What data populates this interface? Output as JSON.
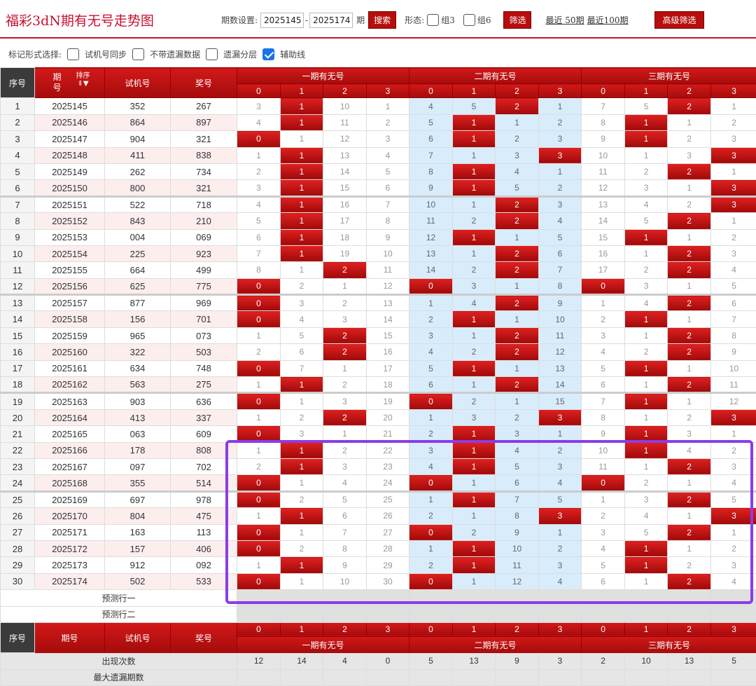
{
  "header": {
    "title": "福彩3dN期有无号走势图",
    "period_label": "期数设置:",
    "period_start": "2025145",
    "period_end": "2025174",
    "period_unit": "期",
    "search": "搜索",
    "form_label": "形态:",
    "group3": "组3",
    "group6": "组6",
    "filter": "筛选",
    "recent50": "最近 50期",
    "recent100": "最近100期",
    "advanced": "高级筛选"
  },
  "options": {
    "label": "标记形式选择:",
    "items": [
      {
        "label": "试机号同步",
        "checked": false
      },
      {
        "label": "不带遗漏数据",
        "checked": false
      },
      {
        "label": "遗漏分层",
        "checked": false
      },
      {
        "label": "辅助线",
        "checked": true
      }
    ]
  },
  "table": {
    "col_seq": "序号",
    "col_period": "期号",
    "col_sort": "排序",
    "col_test": "试机号",
    "col_prize": "奖号",
    "groups": [
      "一期有无号",
      "二期有无号",
      "三期有无号"
    ],
    "digits": [
      "0",
      "1",
      "2",
      "3"
    ],
    "rows": [
      [
        "1",
        "2025145",
        "352",
        "267",
        [
          3,
          "H1",
          10,
          1
        ],
        [
          4,
          5,
          "H2",
          1
        ],
        [
          7,
          5,
          "H2",
          1
        ]
      ],
      [
        "2",
        "2025146",
        "864",
        "897",
        [
          4,
          "H1",
          11,
          2
        ],
        [
          5,
          "H1",
          1,
          2
        ],
        [
          8,
          "H1",
          1,
          2
        ]
      ],
      [
        "3",
        "2025147",
        "904",
        "321",
        [
          "H0",
          1,
          12,
          3
        ],
        [
          6,
          "H1",
          2,
          3
        ],
        [
          9,
          "H1",
          2,
          3
        ]
      ],
      [
        "4",
        "2025148",
        "411",
        "838",
        [
          1,
          "H1",
          13,
          4
        ],
        [
          7,
          1,
          3,
          "H3"
        ],
        [
          10,
          1,
          3,
          "H3"
        ]
      ],
      [
        "5",
        "2025149",
        "262",
        "734",
        [
          2,
          "H1",
          14,
          5
        ],
        [
          8,
          "H1",
          4,
          1
        ],
        [
          11,
          2,
          "H2",
          1
        ]
      ],
      [
        "6",
        "2025150",
        "800",
        "321",
        [
          3,
          "H1",
          15,
          6
        ],
        [
          9,
          "H1",
          5,
          2
        ],
        [
          12,
          3,
          1,
          "H3"
        ]
      ],
      [
        "7",
        "2025151",
        "522",
        "718",
        [
          4,
          "H1",
          16,
          7
        ],
        [
          10,
          1,
          "H2",
          3
        ],
        [
          13,
          4,
          2,
          "H3"
        ]
      ],
      [
        "8",
        "2025152",
        "843",
        "210",
        [
          5,
          "H1",
          17,
          8
        ],
        [
          11,
          2,
          "H2",
          4
        ],
        [
          14,
          5,
          "H2",
          1
        ]
      ],
      [
        "9",
        "2025153",
        "004",
        "069",
        [
          6,
          "H1",
          18,
          9
        ],
        [
          12,
          "H1",
          1,
          5
        ],
        [
          15,
          "H1",
          1,
          2
        ]
      ],
      [
        "10",
        "2025154",
        "225",
        "923",
        [
          7,
          "H1",
          19,
          10
        ],
        [
          13,
          1,
          "H2",
          6
        ],
        [
          16,
          1,
          "H2",
          3
        ]
      ],
      [
        "11",
        "2025155",
        "664",
        "499",
        [
          8,
          1,
          "H2",
          11
        ],
        [
          14,
          2,
          "H2",
          7
        ],
        [
          17,
          2,
          "H2",
          4
        ]
      ],
      [
        "12",
        "2025156",
        "625",
        "775",
        [
          "H0",
          2,
          1,
          12
        ],
        [
          "H0",
          3,
          1,
          8
        ],
        [
          "H0",
          3,
          1,
          5
        ]
      ],
      [
        "13",
        "2025157",
        "877",
        "969",
        [
          "H0",
          3,
          2,
          13
        ],
        [
          1,
          4,
          "H2",
          9
        ],
        [
          1,
          4,
          "H2",
          6
        ]
      ],
      [
        "14",
        "2025158",
        "156",
        "701",
        [
          "H0",
          4,
          3,
          14
        ],
        [
          2,
          "H1",
          1,
          10
        ],
        [
          2,
          "H1",
          1,
          7
        ]
      ],
      [
        "15",
        "2025159",
        "965",
        "073",
        [
          1,
          5,
          "H2",
          15
        ],
        [
          3,
          1,
          "H2",
          11
        ],
        [
          3,
          1,
          "H2",
          8
        ]
      ],
      [
        "16",
        "2025160",
        "322",
        "503",
        [
          2,
          6,
          "H2",
          16
        ],
        [
          4,
          2,
          "H2",
          12
        ],
        [
          4,
          2,
          "H2",
          9
        ]
      ],
      [
        "17",
        "2025161",
        "634",
        "748",
        [
          "H0",
          7,
          1,
          17
        ],
        [
          5,
          "H1",
          1,
          13
        ],
        [
          5,
          "H1",
          1,
          10
        ]
      ],
      [
        "18",
        "2025162",
        "563",
        "275",
        [
          1,
          "H1",
          2,
          18
        ],
        [
          6,
          1,
          "H2",
          14
        ],
        [
          6,
          1,
          "H2",
          11
        ]
      ],
      [
        "19",
        "2025163",
        "903",
        "636",
        [
          "H0",
          1,
          3,
          19
        ],
        [
          "H0",
          2,
          1,
          15
        ],
        [
          7,
          "H1",
          1,
          12
        ]
      ],
      [
        "20",
        "2025164",
        "413",
        "337",
        [
          1,
          2,
          "H2",
          20
        ],
        [
          1,
          3,
          2,
          "H3"
        ],
        [
          8,
          1,
          2,
          "H3"
        ]
      ],
      [
        "21",
        "2025165",
        "063",
        "609",
        [
          "H0",
          3,
          1,
          21
        ],
        [
          2,
          "H1",
          3,
          1
        ],
        [
          9,
          "H1",
          3,
          1
        ]
      ],
      [
        "22",
        "2025166",
        "178",
        "808",
        [
          1,
          "H1",
          2,
          22
        ],
        [
          3,
          "H1",
          4,
          2
        ],
        [
          10,
          "H1",
          4,
          2
        ]
      ],
      [
        "23",
        "2025167",
        "097",
        "702",
        [
          2,
          "H1",
          3,
          23
        ],
        [
          4,
          "H1",
          5,
          3
        ],
        [
          11,
          1,
          "H2",
          3
        ]
      ],
      [
        "24",
        "2025168",
        "355",
        "514",
        [
          "H0",
          1,
          4,
          24
        ],
        [
          "H0",
          1,
          6,
          4
        ],
        [
          "H0",
          2,
          1,
          4
        ]
      ],
      [
        "25",
        "2025169",
        "697",
        "978",
        [
          "H0",
          2,
          5,
          25
        ],
        [
          1,
          "H1",
          7,
          5
        ],
        [
          1,
          3,
          "H2",
          5
        ]
      ],
      [
        "26",
        "2025170",
        "804",
        "475",
        [
          1,
          "H1",
          6,
          26
        ],
        [
          2,
          1,
          8,
          "H3"
        ],
        [
          2,
          4,
          1,
          "H3"
        ]
      ],
      [
        "27",
        "2025171",
        "163",
        "113",
        [
          "H0",
          1,
          7,
          27
        ],
        [
          "H0",
          2,
          9,
          1
        ],
        [
          3,
          5,
          "H2",
          1
        ]
      ],
      [
        "28",
        "2025172",
        "157",
        "406",
        [
          "H0",
          2,
          8,
          28
        ],
        [
          1,
          "H1",
          10,
          2
        ],
        [
          4,
          "H1",
          1,
          2
        ]
      ],
      [
        "29",
        "2025173",
        "912",
        "092",
        [
          1,
          "H1",
          9,
          29
        ],
        [
          2,
          "H1",
          11,
          3
        ],
        [
          5,
          "H1",
          2,
          3
        ]
      ],
      [
        "30",
        "2025174",
        "502",
        "533",
        [
          "H0",
          1,
          10,
          30
        ],
        [
          "H0",
          1,
          12,
          4
        ],
        [
          6,
          1,
          "H2",
          4
        ]
      ]
    ],
    "predict1": "预测行一",
    "predict2": "预测行二",
    "stat_label": "出现次数",
    "stat_values": [
      12,
      14,
      4,
      0,
      5,
      13,
      9,
      3,
      2,
      10,
      13,
      5
    ],
    "max_miss_label": "最大遗漏期数"
  }
}
